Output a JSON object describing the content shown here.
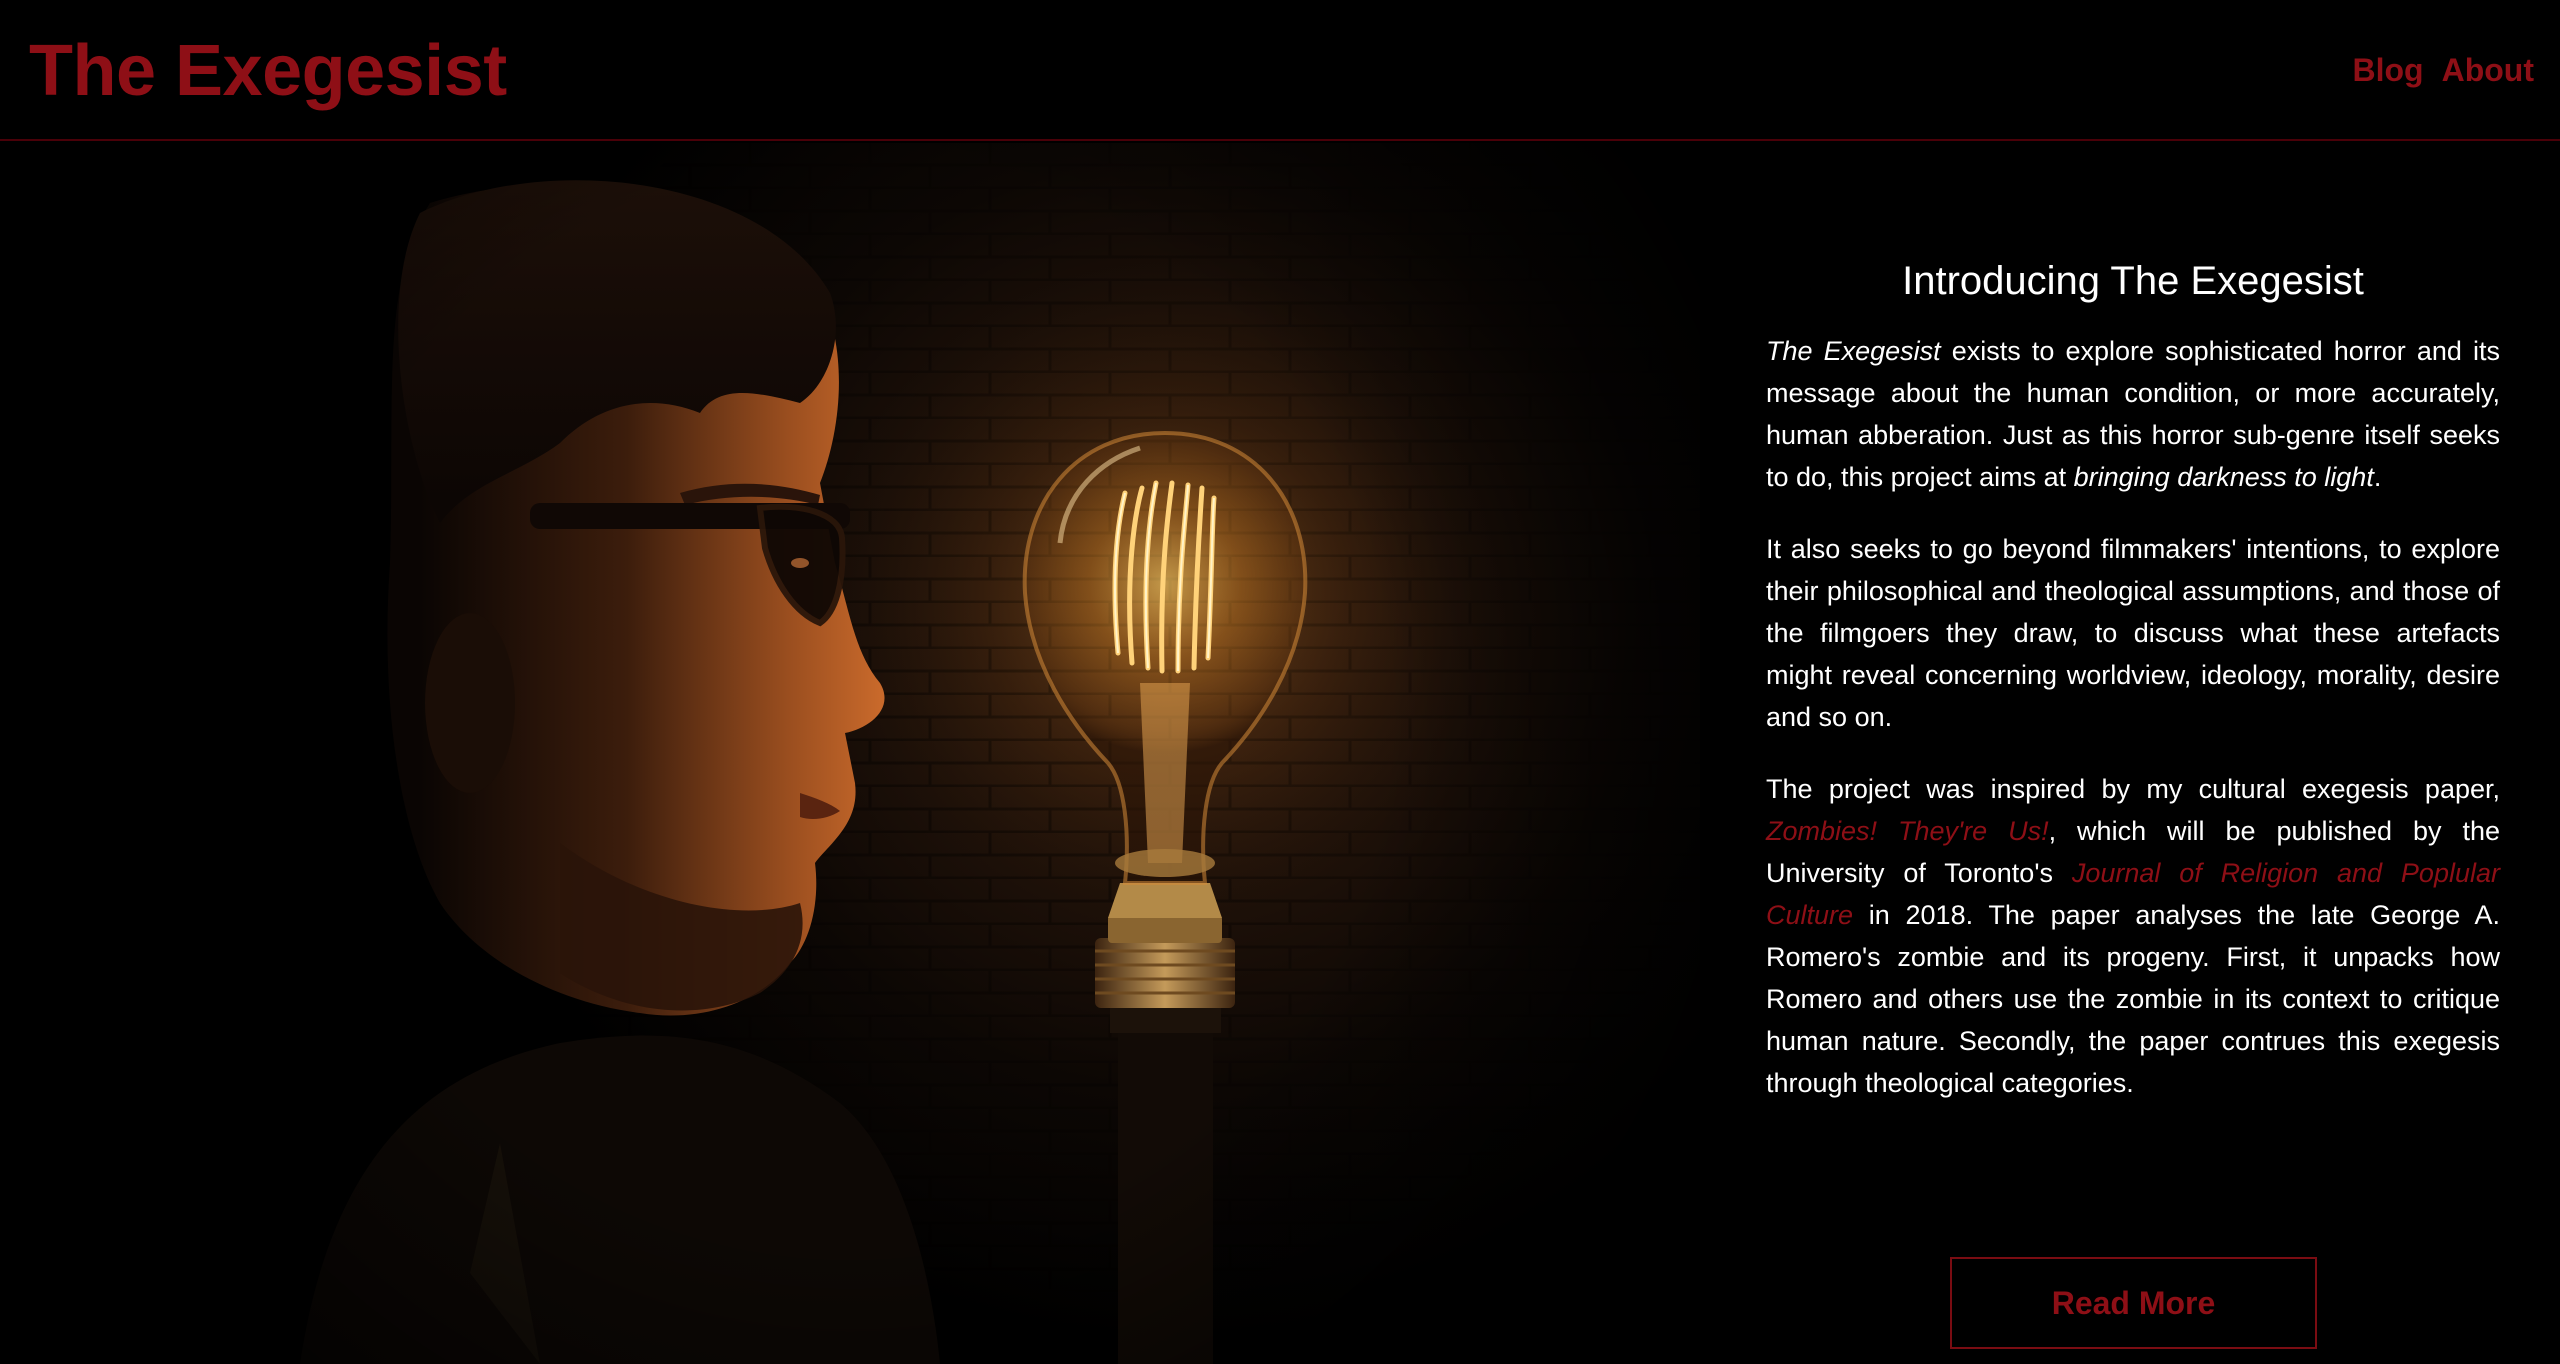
{
  "header": {
    "brand": "The Exegesist",
    "nav": [
      {
        "label": "Blog"
      },
      {
        "label": "About"
      }
    ]
  },
  "colors": {
    "accent": "#8e0f16",
    "background": "#000000",
    "text": "#ffffff",
    "divider": "#4a0008"
  },
  "intro": {
    "heading": "Introducing The Exegesist",
    "p1": {
      "title_em": "The Exegesist",
      "text1": " exists to explore sophisticated horror and its message about the human condition, or more accurately, human abberation. Just as this horror sub-genre itself seeks to do, this project aims at ",
      "em2": "bringing darkness to light",
      "text2": "."
    },
    "p2": "It also seeks to go beyond filmmakers' intentions, to explore their philosophical and theological assumptions, and those of the filmgoers they draw, to discuss what these artefacts might reveal concerning worldview, ideology, morality, desire and so on.",
    "p3": {
      "text1": "The project was inspired by my cultural exegesis paper, ",
      "link1": "Zombies! They're Us!",
      "text2": ", which will be published by the University of Toronto's ",
      "link2": "Journal of Religion and Poplular Culture",
      "text3": " in 2018. The paper analyses the late George A. Romero's zombie and its progeny. First, it unpacks how Romero and others use the zombie in its context to critique human nature. Secondly, the paper contrues this exegesis through theological categories."
    }
  },
  "read_more": {
    "label": "Read More"
  }
}
